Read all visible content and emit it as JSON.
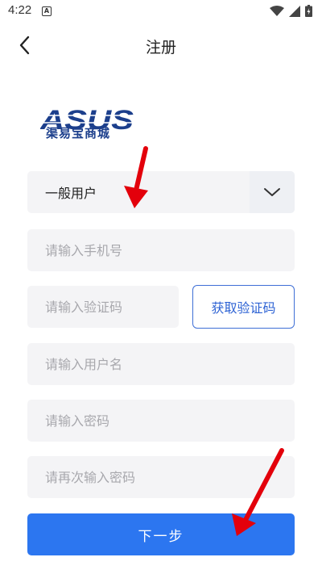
{
  "status_bar": {
    "time": "4:22",
    "notification": "A"
  },
  "nav": {
    "title": "注册"
  },
  "brand": {
    "logo_text": "ASUS",
    "subtitle": "渠易宝商城",
    "color": "#1c3f8c"
  },
  "form": {
    "user_type": {
      "selected": "一般用户"
    },
    "phone": {
      "placeholder": "请输入手机号"
    },
    "code": {
      "placeholder": "请输入验证码",
      "button_label": "获取验证码"
    },
    "username": {
      "placeholder": "请输入用户名"
    },
    "password": {
      "placeholder": "请输入密码"
    },
    "confirm_password": {
      "placeholder": "请再次输入密码"
    },
    "submit_label": "下一步"
  },
  "colors": {
    "accent": "#2c76f0",
    "field_bg": "#f4f4f6",
    "annotation_arrow": "#e3000b"
  }
}
